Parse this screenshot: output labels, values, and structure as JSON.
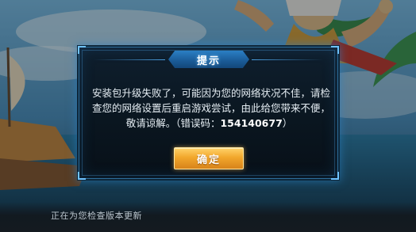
{
  "dialog": {
    "title": "提示",
    "message_line1": "安装包升级失败了，可能因为您的网络状况不佳，请检",
    "message_line2": "查您的网络设置后重启游戏尝试，由此给您带来不便，",
    "message_line3_prefix": "敬请谅解。（错误码：",
    "error_code": "154140677",
    "message_line3_suffix": "）",
    "confirm_label": "确定"
  },
  "status_bar": {
    "text": "正在为您检查版本更新"
  },
  "colors": {
    "dialog_border": "#2e6f9c",
    "title_plate": "#1a5a96",
    "button_gold": "#f2a72c"
  }
}
